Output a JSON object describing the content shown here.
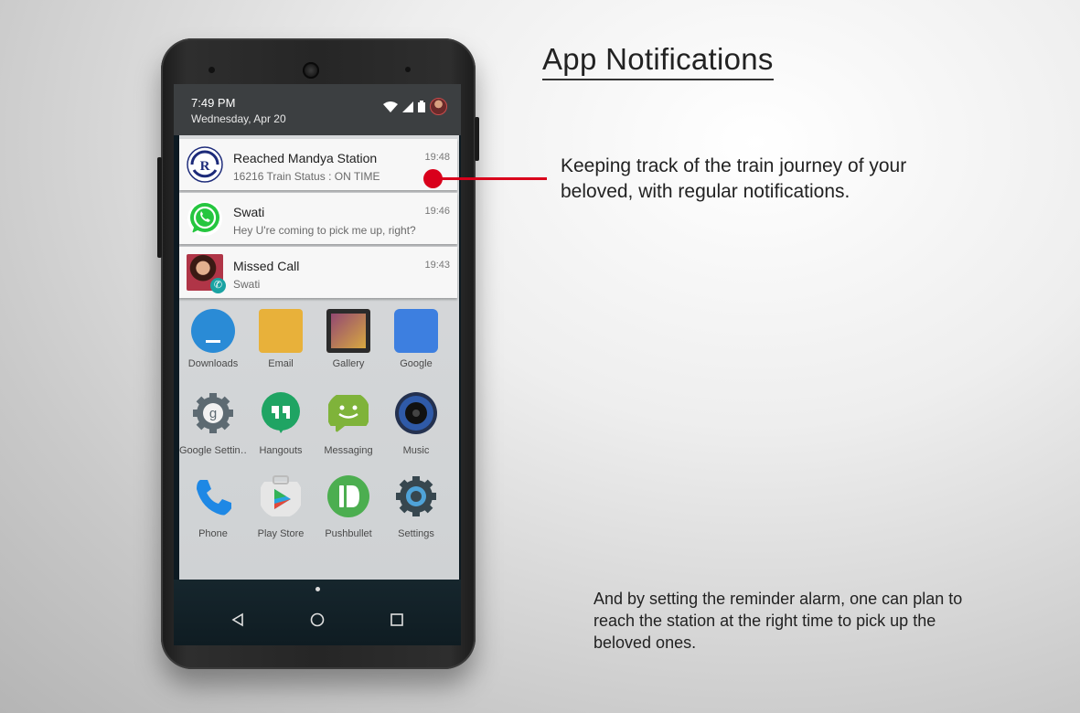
{
  "page": {
    "heading": "App Notifications",
    "description_1": "Keeping track of the train journey of your beloved, with regular notifications.",
    "description_2": "And by setting the reminder alarm, one can plan to reach the station at the right time to pick up the beloved ones.",
    "accent_color": "#d9001b"
  },
  "status_bar": {
    "time": "7:49 PM",
    "date": "Wednesday, Apr 20",
    "icons": [
      "wifi-icon",
      "signal-icon",
      "battery-icon",
      "user-avatar"
    ]
  },
  "notifications": [
    {
      "title": "Reached Mandya Station",
      "text": "16216 Train Status : ON TIME",
      "time": "19:48",
      "icon": "irctc-logo-icon"
    },
    {
      "title": "Swati",
      "text": "Hey U're coming to pick me up, right?",
      "time": "19:46",
      "icon": "whatsapp-icon"
    },
    {
      "title": "Missed Call",
      "text": "Swati",
      "time": "19:43",
      "icon": "contact-photo"
    }
  ],
  "apps": [
    {
      "label": "Downloads",
      "icon": "downloads-icon",
      "color": "#2a8bd6"
    },
    {
      "label": "Email",
      "icon": "email-icon",
      "color": "#e8b13a"
    },
    {
      "label": "Gallery",
      "icon": "gallery-icon",
      "color": "#8a3c78"
    },
    {
      "label": "Google",
      "icon": "google-icon",
      "color": "#3d7fe0"
    },
    {
      "label": "Google Settin…",
      "icon": "google-settings-icon",
      "color": "#5d6a72"
    },
    {
      "label": "Hangouts",
      "icon": "hangouts-icon",
      "color": "#1fa463"
    },
    {
      "label": "Messaging",
      "icon": "messaging-icon",
      "color": "#7fb33a"
    },
    {
      "label": "Music",
      "icon": "music-icon",
      "color": "#24314f"
    },
    {
      "label": "Phone",
      "icon": "phone-icon",
      "color": "#1e88e5"
    },
    {
      "label": "Play Store",
      "icon": "play-store-icon",
      "color": "#e6e6e6"
    },
    {
      "label": "Pushbullet",
      "icon": "pushbullet-icon",
      "color": "#4cae50"
    },
    {
      "label": "Settings",
      "icon": "settings-icon",
      "color": "#37474f"
    }
  ],
  "nav": [
    "back-icon",
    "home-icon",
    "recents-icon"
  ]
}
